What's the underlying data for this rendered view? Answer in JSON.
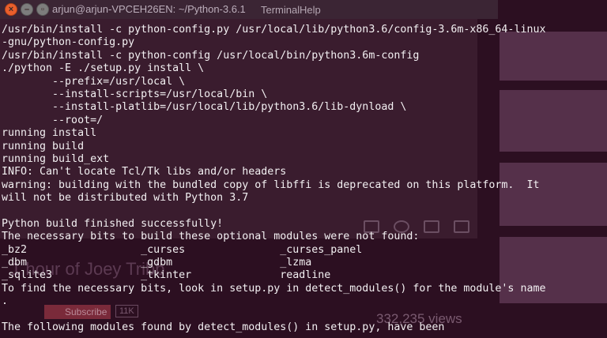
{
  "window": {
    "title": "arjun@arjun-VPCEH26EN: ~/Python-3.6.1",
    "menu": [
      "Terminal",
      "Help"
    ]
  },
  "background": {
    "video_title": "1 hour of Joey Tribb",
    "subscribe_label": "Subscribe",
    "subscriber_count": "11K",
    "views": "332,235 views"
  },
  "terminal": {
    "lines": [
      "/usr/bin/install -c python-config.py /usr/local/lib/python3.6/config-3.6m-x86_64-linux",
      "-gnu/python-config.py",
      "/usr/bin/install -c python-config /usr/local/bin/python3.6m-config",
      "./python -E ./setup.py install \\",
      "        --prefix=/usr/local \\",
      "        --install-scripts=/usr/local/bin \\",
      "        --install-platlib=/usr/local/lib/python3.6/lib-dynload \\",
      "        --root=/",
      "running install",
      "running build",
      "running build_ext",
      "INFO: Can't locate Tcl/Tk libs and/or headers",
      "warning: building with the bundled copy of libffi is deprecated on this platform.  It",
      "will not be distributed with Python 3.7",
      "",
      "Python build finished successfully!",
      "The necessary bits to build these optional modules were not found:",
      "_bz2                  _curses               _curses_panel",
      "_dbm                  _gdbm                 _lzma",
      "_sqlite3              _tkinter              readline",
      "To find the necessary bits, look in setup.py in detect_modules() for the module's name",
      ".",
      "",
      "The following modules found by detect_modules() in setup.py, have been"
    ]
  }
}
